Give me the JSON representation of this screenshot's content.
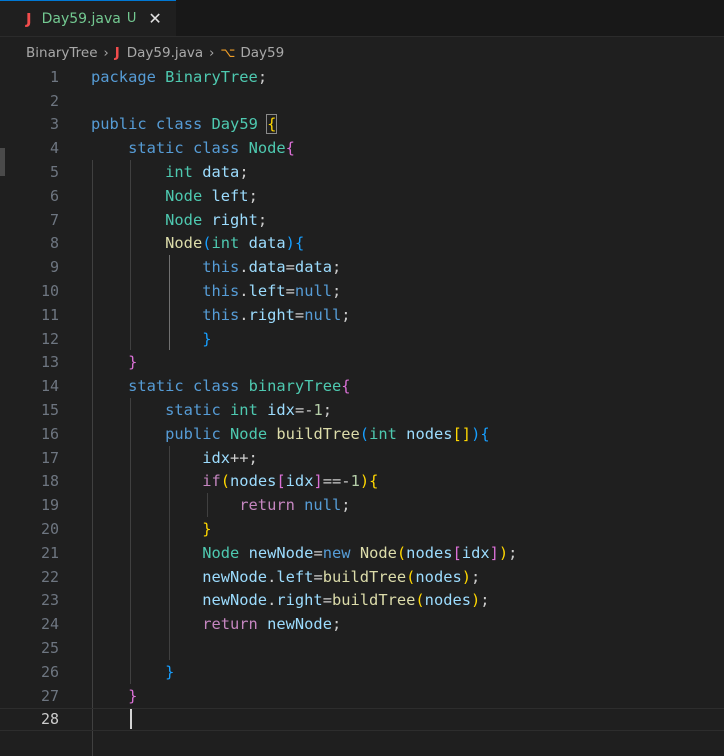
{
  "tab": {
    "icon": "J",
    "filename": "Day59.java",
    "status": "U",
    "close": "✕"
  },
  "breadcrumb": {
    "folder": "BinaryTree",
    "file_icon": "J",
    "file": "Day59.java",
    "symbol_icon": "class-icon",
    "symbol": "Day59"
  },
  "editor": {
    "current_line": 28,
    "lines": [
      {
        "n": "1"
      },
      {
        "n": "2"
      },
      {
        "n": "3"
      },
      {
        "n": "4"
      },
      {
        "n": "5"
      },
      {
        "n": "6"
      },
      {
        "n": "7"
      },
      {
        "n": "8"
      },
      {
        "n": "9"
      },
      {
        "n": "10"
      },
      {
        "n": "11"
      },
      {
        "n": "12"
      },
      {
        "n": "13"
      },
      {
        "n": "14"
      },
      {
        "n": "15"
      },
      {
        "n": "16"
      },
      {
        "n": "17"
      },
      {
        "n": "18"
      },
      {
        "n": "19"
      },
      {
        "n": "20"
      },
      {
        "n": "21"
      },
      {
        "n": "22"
      },
      {
        "n": "23"
      },
      {
        "n": "24"
      },
      {
        "n": "25"
      },
      {
        "n": "26"
      },
      {
        "n": "27"
      },
      {
        "n": "28"
      }
    ],
    "code": [
      "package BinaryTree;",
      "",
      "public class Day59 {",
      "    static class Node{",
      "        int data;",
      "        Node left;",
      "        Node right;",
      "        Node(int data){",
      "            this.data=data;",
      "            this.left=null;",
      "            this.right=null;",
      "            }",
      "    }",
      "    static class binaryTree{",
      "        static int idx=-1;",
      "        public Node buildTree(int nodes[]){",
      "            idx++;",
      "            if(nodes[idx]==-1){",
      "                return null;",
      "            }",
      "            Node newNode=new Node(nodes[idx]);",
      "            newNode.left=buildTree(nodes);",
      "            newNode.right=buildTree(nodes);",
      "            return newNode;",
      "",
      "        }",
      "    }",
      ""
    ]
  },
  "colors": {
    "keyword": "#569cd6",
    "type": "#4ec9b0",
    "variable": "#9cdcfe",
    "function": "#dcdcaa",
    "number": "#b5cea8",
    "control": "#c586c0",
    "git_untracked": "#73c991",
    "java_icon": "#f14c4c"
  }
}
